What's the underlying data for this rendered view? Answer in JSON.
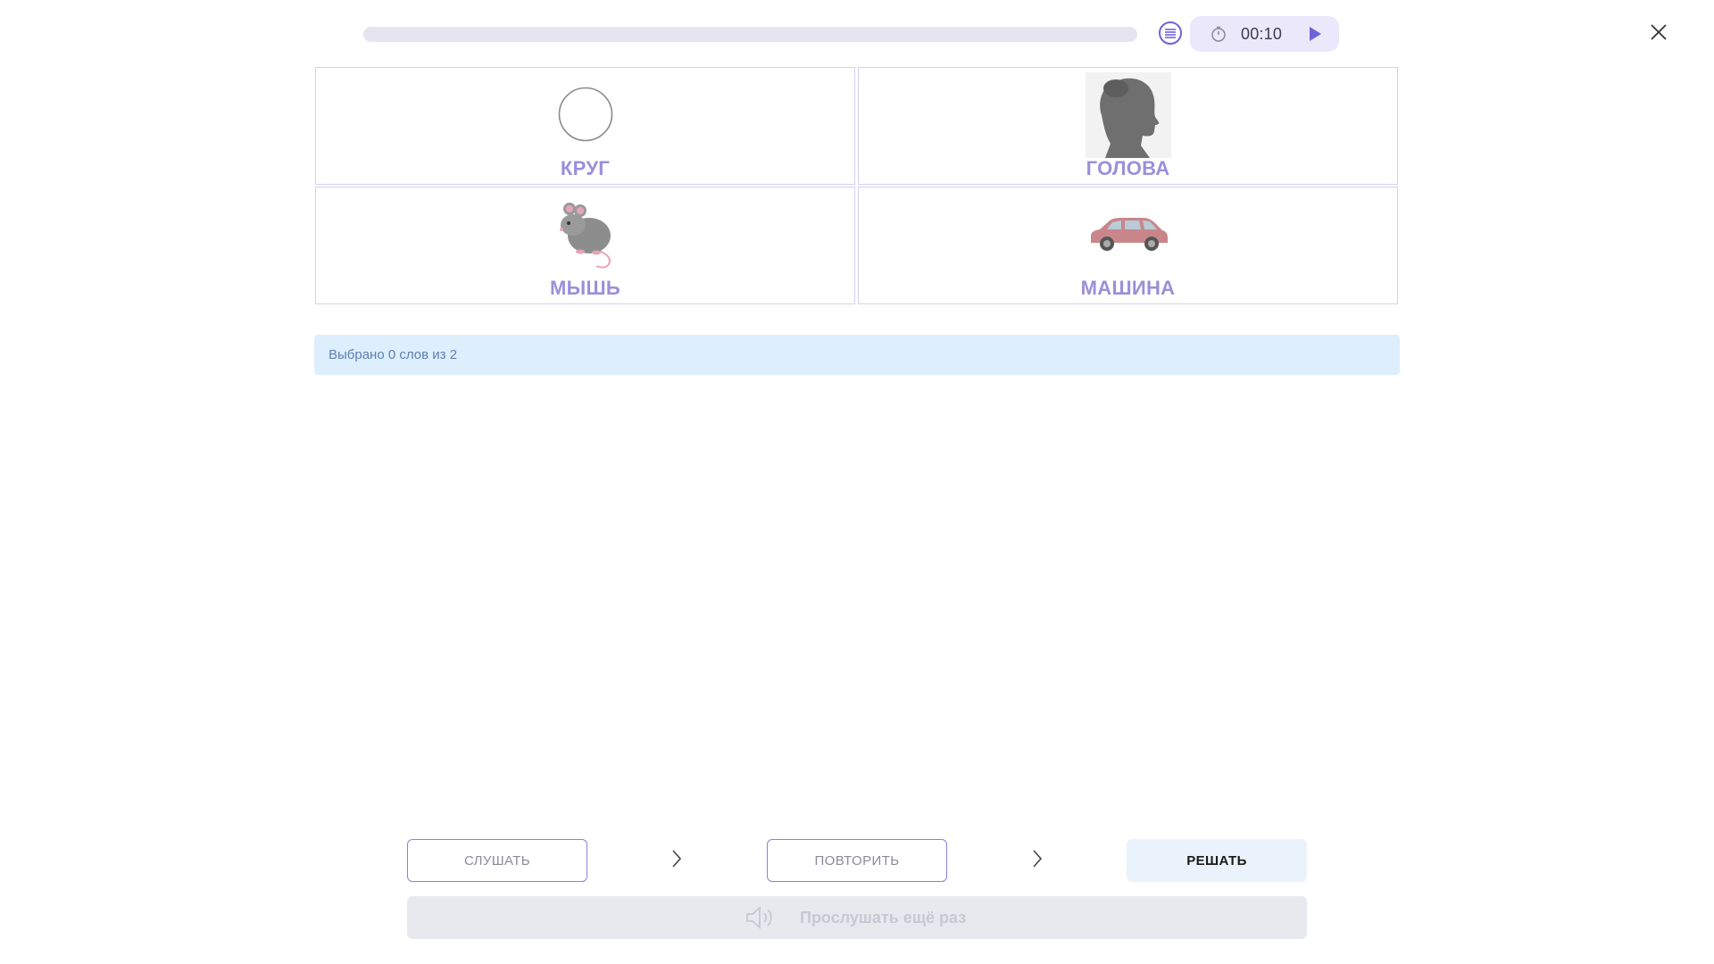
{
  "header": {
    "progress_fraction": 0.0,
    "timer": "00:10",
    "icons": {
      "list": "list-icon",
      "timer": "stopwatch-icon",
      "play": "play-icon",
      "close": "close-icon"
    }
  },
  "cards": [
    {
      "word": "КРУГ",
      "image": "circle-image"
    },
    {
      "word": "ГОЛОВА",
      "image": "head-silhouette-image"
    },
    {
      "word": "МЫШЬ",
      "image": "mouse-image"
    },
    {
      "word": "МАШИНА",
      "image": "car-image"
    }
  ],
  "status": {
    "selected_text": "Выбрано 0 слов из 2"
  },
  "steps": {
    "listen_label": "СЛУШАТЬ",
    "repeat_label": "ПОВТОРИТЬ",
    "solve_label": "РЕШАТЬ"
  },
  "replay": {
    "label": "Прослушать ещё раз",
    "icon": "speaker-icon"
  },
  "colors": {
    "accent": "#6f64d6",
    "card_word": "#9a90d8",
    "info_bg": "#ddeefc"
  }
}
